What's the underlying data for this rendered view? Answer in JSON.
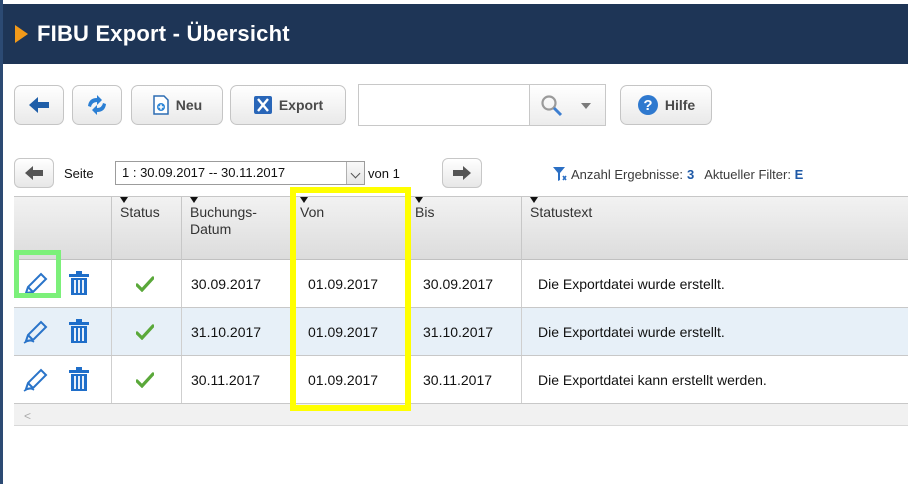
{
  "header": {
    "title": "FIBU Export - Übersicht"
  },
  "toolbar": {
    "back_icon": "arrow-left-icon",
    "refresh_icon": "refresh-icon",
    "new_label": "Neu",
    "export_label": "Export",
    "search_value": "",
    "help_label": "Hilfe"
  },
  "pager": {
    "page_label": "Seite",
    "page_select_value": "1 : 30.09.2017 -- 30.11.2017",
    "of_label": "von 1",
    "results_label": "Anzahl Ergebnisse:",
    "results_count": "3",
    "filter_label": "Aktueller Filter:",
    "filter_value": "E"
  },
  "table": {
    "columns": [
      "",
      "Status",
      "Buchungs-Datum",
      "Von",
      "Bis",
      "Statustext"
    ],
    "rows": [
      {
        "status": "ok",
        "buchungsdatum": "30.09.2017",
        "von": "01.09.2017",
        "bis": "30.09.2017",
        "statustext": "Die Exportdatei wurde erstellt."
      },
      {
        "status": "ok",
        "buchungsdatum": "31.10.2017",
        "von": "01.09.2017",
        "bis": "31.10.2017",
        "statustext": "Die Exportdatei wurde erstellt."
      },
      {
        "status": "ok",
        "buchungsdatum": "30.11.2017",
        "von": "01.09.2017",
        "bis": "30.11.2017",
        "statustext": "Die Exportdatei kann erstellt werden."
      }
    ],
    "scroll_left_glyph": "<"
  },
  "colors": {
    "title_bar": "#1e3556",
    "accent_orange": "#f29a1a",
    "link_blue": "#1d58a6",
    "check_green": "#5aa83a",
    "highlight_yellow": "#ffff00",
    "highlight_green": "#7cf07a"
  }
}
